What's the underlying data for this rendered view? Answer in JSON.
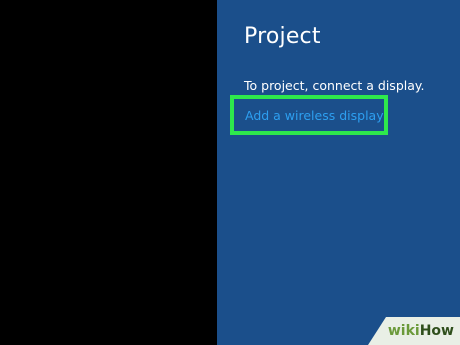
{
  "project_pane": {
    "title": "Project",
    "message": "To project, connect a display.",
    "add_wireless_display_link": "Add a wireless display"
  },
  "watermark": {
    "part1": "wiki",
    "part2": "How"
  },
  "colors": {
    "pane_background": "#1b4f8b",
    "link": "#2d9ff0",
    "highlight": "#2ee84c",
    "left_background": "#000000"
  }
}
